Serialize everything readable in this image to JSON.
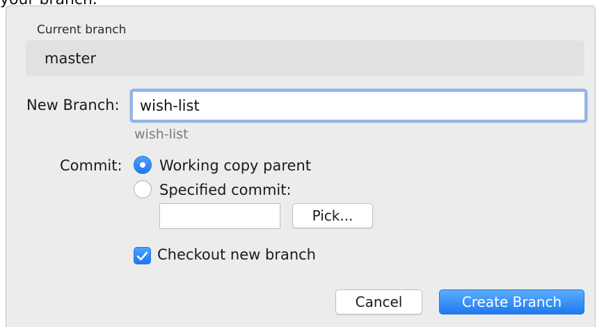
{
  "intro_text": "your branch.",
  "dialog": {
    "current_branch": {
      "label": "Current branch",
      "value": "master"
    },
    "new_branch": {
      "label": "New Branch:",
      "value": "wish-list",
      "preview": "wish-list"
    },
    "commit": {
      "label": "Commit:",
      "options": [
        {
          "label": "Working copy parent",
          "selected": true
        },
        {
          "label": "Specified commit:",
          "selected": false
        }
      ],
      "specified_value": "",
      "pick_label": "Pick..."
    },
    "checkout": {
      "label": "Checkout new branch",
      "checked": true
    },
    "buttons": {
      "cancel": "Cancel",
      "create": "Create Branch"
    },
    "colors": {
      "accent": "#1e79f1",
      "focus_ring": "#8fb4ec"
    }
  }
}
